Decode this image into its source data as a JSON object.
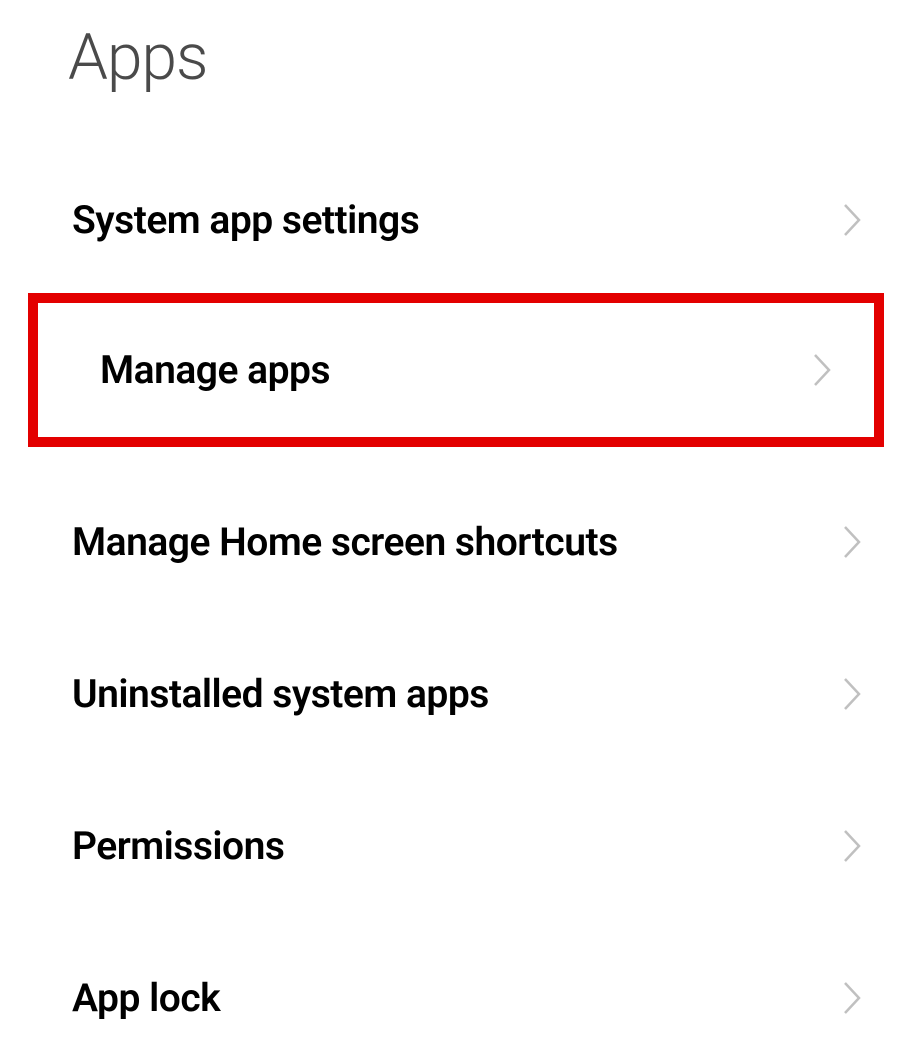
{
  "page": {
    "title": "Apps"
  },
  "settings": {
    "items": [
      {
        "label": "System app settings",
        "highlighted": false
      },
      {
        "label": "Manage apps",
        "highlighted": true
      },
      {
        "label": "Manage Home screen shortcuts",
        "highlighted": false
      },
      {
        "label": "Uninstalled system apps",
        "highlighted": false
      },
      {
        "label": "Permissions",
        "highlighted": false
      },
      {
        "label": "App lock",
        "highlighted": false
      }
    ]
  },
  "highlight_color": "#e30000"
}
